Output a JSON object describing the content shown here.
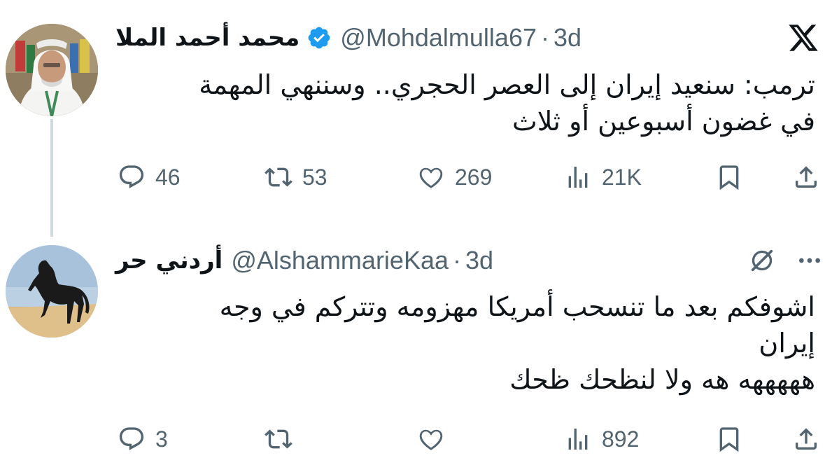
{
  "tweets": [
    {
      "author_name": "محمد أحمد الملا",
      "verified": true,
      "handle": "@Mohdalmulla67",
      "separator": "·",
      "time": "3d",
      "text_lines": [
        "ترمب: سنعيد إيران إلى العصر الحجري.. وسننهي المهمة",
        "في غضون أسبوعين أو ثلاث"
      ],
      "replies": "46",
      "retweets": "53",
      "likes": "269",
      "views": "21K",
      "top_right_icon": "x-logo-icon"
    },
    {
      "author_name": "أردني حر",
      "verified": false,
      "handle": "@AlshammarieKaa",
      "separator": "·",
      "time": "3d",
      "text_lines": [
        "اشوفكم بعد ما تنسحب أمريكا مهزومه وتتركم في وجه",
        "إيران",
        "هههههه هه ولا لنظحك ظحك"
      ],
      "replies": "3",
      "retweets": "",
      "likes": "",
      "views": "892",
      "top_right_icons": [
        "grok-icon",
        "more-icon"
      ]
    }
  ],
  "colors": {
    "text": "#0f1419",
    "secondary": "#536471",
    "verified_blue": "#1d9bf0",
    "thread_line": "#cfd9de"
  }
}
